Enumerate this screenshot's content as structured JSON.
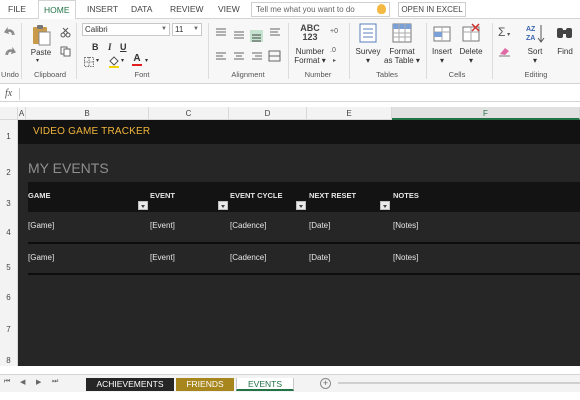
{
  "menu": {
    "tabs": [
      "FILE",
      "HOME",
      "INSERT",
      "DATA",
      "REVIEW",
      "VIEW"
    ],
    "active_tab": "HOME",
    "tell_me_placeholder": "Tell me what you want to do",
    "open_in_excel": "OPEN IN EXCEL"
  },
  "ribbon": {
    "groups": {
      "undo": "Undo",
      "clipboard": "Clipboard",
      "font": "Font",
      "alignment": "Alignment",
      "number": "Number",
      "tables": "Tables",
      "cells": "Cells",
      "editing": "Editing"
    },
    "paste_label": "Paste",
    "font_name": "Calibri",
    "font_size": "11",
    "bold": "B",
    "italic": "I",
    "underline": "U",
    "font_color_letter": "A",
    "number_format_icon_text": "ABC\n123",
    "number_format_label": "Number Format",
    "number_format_label_line1": "Number",
    "number_format_label_line2": "Format",
    "survey_label": "Survey",
    "format_table_line1": "Format",
    "format_table_line2": "as Table",
    "insert_label": "Insert",
    "delete_label": "Delete",
    "sum_symbol": "Σ",
    "sort_label": "Sort",
    "find_label": "Find"
  },
  "formula_bar": {
    "fx": "fx",
    "value": ""
  },
  "grid": {
    "columns": [
      "A",
      "B",
      "C",
      "D",
      "E",
      "F"
    ],
    "selected_column": "F",
    "rows": [
      "1",
      "2",
      "3",
      "4",
      "5",
      "6",
      "7",
      "8"
    ]
  },
  "sheet": {
    "title": "VIDEO GAME TRACKER",
    "section_title": "MY EVENTS",
    "headers": [
      "GAME",
      "EVENT",
      "EVENT CYCLE",
      "NEXT RESET",
      "NOTES"
    ],
    "rows": [
      [
        "[Game]",
        "[Event]",
        "[Cadence]",
        "[Date]",
        "[Notes]"
      ],
      [
        "[Game]",
        "[Event]",
        "[Cadence]",
        "[Date]",
        "[Notes]"
      ]
    ]
  },
  "sheet_tabs": [
    {
      "label": "ACHIEVEMENTS",
      "bg": "#262626",
      "fg": "#ffffff"
    },
    {
      "label": "FRIENDS",
      "bg": "#a8861e",
      "fg": "#ffffff"
    },
    {
      "label": "EVENTS",
      "bg": "#ffffff",
      "fg": "#217346"
    }
  ],
  "colors": {
    "accent_green": "#217346",
    "title_gold": "#f0b43c",
    "sheet_bg": "#262626",
    "title_bg": "#121212"
  }
}
